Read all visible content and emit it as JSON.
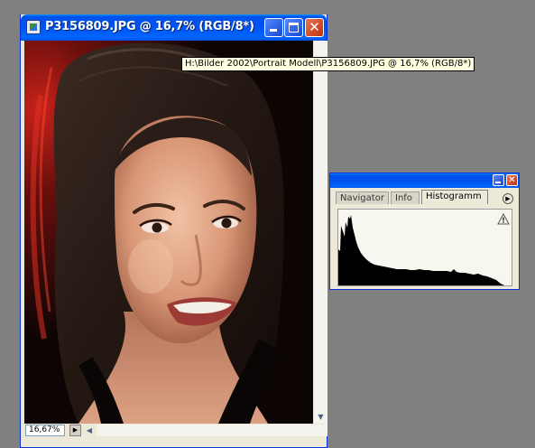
{
  "document_window": {
    "title": "P3156809.JPG @ 16,7% (RGB/8*)",
    "zoom_value": "16,67%",
    "buttons": {
      "minimize": "minimize",
      "maximize": "maximize",
      "close": "close"
    }
  },
  "tooltip": {
    "text": "H:\\Bilder 2002\\Portrait Modell\\P3156809.JPG @ 16,7% (RGB/8*)"
  },
  "palette": {
    "tabs": [
      {
        "label": "Navigator",
        "active": false
      },
      {
        "label": "Info",
        "active": false
      },
      {
        "label": "Histogramm",
        "active": true
      }
    ],
    "warning_icon": "warning-icon"
  },
  "colors": {
    "desktop_background": "#808080",
    "titlebar_blue": "#0053ee",
    "close_red": "#d24a2a",
    "histogram_fill": "#000000"
  }
}
